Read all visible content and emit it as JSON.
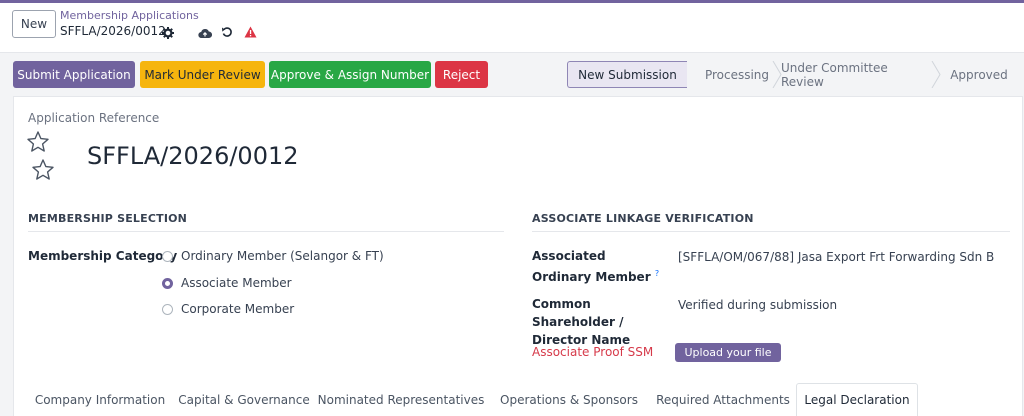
{
  "breadcrumb": {
    "new_label": "New",
    "parent": "Membership Applications",
    "record": "SFFLA/2026/0012"
  },
  "icons": {
    "gear": "gear-icon",
    "cloud": "cloud-upload-icon",
    "undo": "undo-icon",
    "warning": "warning-icon"
  },
  "actions": {
    "submit": "Submit Application",
    "review": "Mark Under Review",
    "approve": "Approve & Assign Number",
    "reject": "Reject"
  },
  "statusbar": {
    "stages": [
      "New Submission",
      "Processing",
      "Under Committee Review",
      "Approved"
    ],
    "active": "New Submission"
  },
  "form": {
    "ref_label": "Application Reference",
    "ref_value": "SFFLA/2026/0012",
    "membership_section": "MEMBERSHIP SELECTION",
    "membership_category_label": "Membership Category",
    "membership_options": [
      "Ordinary Member (Selangor & FT)",
      "Associate Member",
      "Corporate Member"
    ],
    "membership_selected": "Associate Member",
    "linkage_section": "ASSOCIATE LINKAGE VERIFICATION",
    "associated_ordinary_label": "Associated Ordinary Member",
    "associated_ordinary_help": "?",
    "associated_ordinary_value": "[SFFLA/OM/067/88] Jasa Export Frt Forwarding Sdn B",
    "common_label": "Common Shareholder / Director Name",
    "common_value": "Verified during submission",
    "proof_label": "Associate Proof SSM",
    "upload_label": "Upload your file"
  },
  "tabs": {
    "items": [
      "Company Information",
      "Capital & Governance",
      "Nominated Representatives",
      "Operations & Sponsors",
      "Required Attachments",
      "Legal Declaration"
    ],
    "active": "Legal Declaration"
  },
  "colors": {
    "primary": "#71639e",
    "warning": "#f6b50e",
    "success": "#28a745",
    "danger": "#dc3545"
  }
}
